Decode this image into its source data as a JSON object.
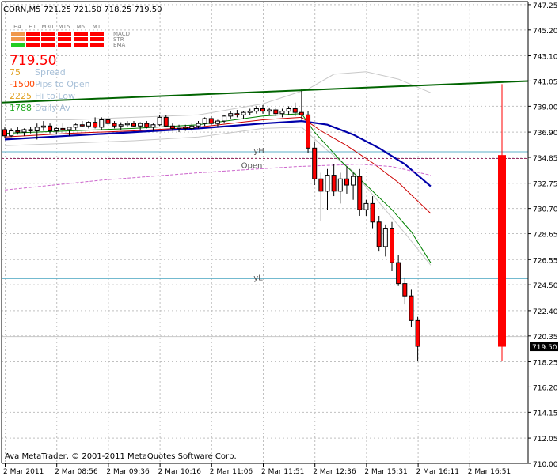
{
  "header": {
    "symbol": "CORN,M5",
    "ohlc": "721.25 721.50 718.25 719.50"
  },
  "indicator_panel": {
    "timeframes": [
      "H4",
      "H1",
      "M30",
      "M15",
      "M5",
      "M1"
    ],
    "row_labels": [
      "MACD",
      "STR",
      "EMA"
    ],
    "row_colors": [
      [
        "#f0984c",
        "#ff0000",
        "#ff0000",
        "#ff0000",
        "#ff0000",
        "#ff0000"
      ],
      [
        "#f0984c",
        "#ff0000",
        "#ff0000",
        "#ff0000",
        "#ff0000",
        "#ff0000"
      ],
      [
        "#22cc22",
        "#ff0000",
        "#ff0000",
        "#ff0000",
        "#ff0000",
        "#ff0000"
      ]
    ],
    "price": "719.50",
    "stats": [
      {
        "value": "75",
        "label": "Spread",
        "value_color": "#e0a020",
        "label_color": "#a8c0d8"
      },
      {
        "value": "-1500",
        "label": "Pips to Open",
        "value_color": "#ff4400",
        "label_color": "#a8c0d8"
      },
      {
        "value": "2225",
        "label": "Hi to Low",
        "value_color": "#e0a020",
        "label_color": "#a8c0d8"
      },
      {
        "value": "1788",
        "label": "Daily Av",
        "value_color": "#22aa22",
        "label_color": "#a8c0d8"
      }
    ]
  },
  "footer": {
    "copyright": "Ava MetaTrader, © 2001-2011 MetaQuotes Software Corp."
  },
  "chart_data": {
    "type": "candlestick",
    "y_range": [
      710.0,
      747.5
    ],
    "x_ticks": [
      {
        "index": 0,
        "label": "2 Mar 2011"
      },
      {
        "index": 8,
        "label": "2 Mar 08:56"
      },
      {
        "index": 16,
        "label": "2 Mar 09:36"
      },
      {
        "index": 24,
        "label": "2 Mar 10:16"
      },
      {
        "index": 32,
        "label": "2 Mar 11:06"
      },
      {
        "index": 40,
        "label": "2 Mar 11:51"
      },
      {
        "index": 48,
        "label": "2 Mar 12:36"
      },
      {
        "index": 56,
        "label": "2 Mar 15:31"
      },
      {
        "index": 64,
        "label": "2 Mar 16:11"
      },
      {
        "index": 72,
        "label": "2 Mar 16:51"
      }
    ],
    "y_ticks": [
      "747.25",
      "745.20",
      "743.10",
      "741.05",
      "739.00",
      "736.90",
      "734.85",
      "732.75",
      "730.70",
      "728.65",
      "726.55",
      "724.50",
      "722.40",
      "720.35",
      "718.25",
      "716.20",
      "714.15",
      "712.05",
      "710.00"
    ],
    "current_price": "719.50",
    "horizontal_lines": [
      {
        "label": "yH",
        "value": 735.3,
        "color": "#5fb0c8",
        "style": "solid"
      },
      {
        "label": "Open",
        "value": 734.75,
        "color": "#993366",
        "style": "dashed"
      },
      {
        "label": "yL",
        "value": 725.0,
        "color": "#5fb0c8",
        "style": "solid"
      },
      {
        "label": "",
        "value": 720.3,
        "color": "#c8c8c8",
        "style": "solid"
      }
    ],
    "trend_line": {
      "start": [
        0,
        739.3
      ],
      "end": [
        82,
        741.05
      ],
      "color": "#006400"
    },
    "candles": [
      [
        737.1,
        737.3,
        736.4,
        736.6
      ],
      [
        736.6,
        737.2,
        736.5,
        737.0
      ],
      [
        737.0,
        737.3,
        736.7,
        736.9
      ],
      [
        736.9,
        737.2,
        736.6,
        737.1
      ],
      [
        737.1,
        737.3,
        736.8,
        737.0
      ],
      [
        737.0,
        737.6,
        736.3,
        737.3
      ],
      [
        737.3,
        737.8,
        737.0,
        737.4
      ],
      [
        737.4,
        737.6,
        736.8,
        737.0
      ],
      [
        737.0,
        737.3,
        736.7,
        737.2
      ],
      [
        737.2,
        737.6,
        737.0,
        737.1
      ],
      [
        737.1,
        737.3,
        736.6,
        737.3
      ],
      [
        737.3,
        737.6,
        737.1,
        737.5
      ],
      [
        737.5,
        737.8,
        737.3,
        737.4
      ],
      [
        737.4,
        737.8,
        737.2,
        737.7
      ],
      [
        737.7,
        738.1,
        737.2,
        737.3
      ],
      [
        737.3,
        738.1,
        737.1,
        737.9
      ],
      [
        737.9,
        738.0,
        737.5,
        737.6
      ],
      [
        737.6,
        737.8,
        737.2,
        737.4
      ],
      [
        737.4,
        737.7,
        737.1,
        737.5
      ],
      [
        737.5,
        737.8,
        737.3,
        737.6
      ],
      [
        737.6,
        737.8,
        737.3,
        737.4
      ],
      [
        737.4,
        737.7,
        737.1,
        737.6
      ],
      [
        737.6,
        737.8,
        737.2,
        737.3
      ],
      [
        737.3,
        737.6,
        737.0,
        737.5
      ],
      [
        737.5,
        738.3,
        737.4,
        738.1
      ],
      [
        738.1,
        738.3,
        737.3,
        737.4
      ],
      [
        737.4,
        737.6,
        737.0,
        737.2
      ],
      [
        737.2,
        737.5,
        736.9,
        737.3
      ],
      [
        737.3,
        737.5,
        737.0,
        737.2
      ],
      [
        737.2,
        737.6,
        737.0,
        737.4
      ],
      [
        737.4,
        737.8,
        737.2,
        737.6
      ],
      [
        737.6,
        738.1,
        737.4,
        738.0
      ],
      [
        738.0,
        738.2,
        737.5,
        737.6
      ],
      [
        737.6,
        737.9,
        737.3,
        737.8
      ],
      [
        737.8,
        738.3,
        737.6,
        738.2
      ],
      [
        738.2,
        738.6,
        738.0,
        738.4
      ],
      [
        738.4,
        738.7,
        738.1,
        738.3
      ],
      [
        738.3,
        738.6,
        738.0,
        738.5
      ],
      [
        738.5,
        738.8,
        738.3,
        738.6
      ],
      [
        738.6,
        739.0,
        738.4,
        738.8
      ],
      [
        738.8,
        739.1,
        738.4,
        738.6
      ],
      [
        738.6,
        738.9,
        738.3,
        738.7
      ],
      [
        738.7,
        738.9,
        738.2,
        738.4
      ],
      [
        738.4,
        738.8,
        738.1,
        738.6
      ],
      [
        738.6,
        739.0,
        738.3,
        738.8
      ],
      [
        738.8,
        739.3,
        738.2,
        738.5
      ],
      [
        738.5,
        740.4,
        737.9,
        738.3
      ],
      [
        738.3,
        738.6,
        735.2,
        735.6
      ],
      [
        735.6,
        736.1,
        732.6,
        733.1
      ],
      [
        733.1,
        733.6,
        729.7,
        732.1
      ],
      [
        732.1,
        733.9,
        730.6,
        733.4
      ],
      [
        733.4,
        734.3,
        731.7,
        732.1
      ],
      [
        732.1,
        733.6,
        731.1,
        733.1
      ],
      [
        733.1,
        734.1,
        731.9,
        732.6
      ],
      [
        732.6,
        733.6,
        731.4,
        733.3
      ],
      [
        733.3,
        733.9,
        730.1,
        730.6
      ],
      [
        730.6,
        731.4,
        730.1,
        731.1
      ],
      [
        731.1,
        731.7,
        729.1,
        729.6
      ],
      [
        729.6,
        730.1,
        727.2,
        727.6
      ],
      [
        727.6,
        729.4,
        726.8,
        729.1
      ],
      [
        729.1,
        729.6,
        725.6,
        726.3
      ],
      [
        726.3,
        726.9,
        724.4,
        724.6
      ],
      [
        724.6,
        725.1,
        722.9,
        723.6
      ],
      [
        723.6,
        724.1,
        721.1,
        721.6
      ],
      [
        721.6,
        721.9,
        718.3,
        719.5
      ],
      [
        735.0,
        740.8,
        718.3,
        719.5
      ]
    ],
    "ma_series": [
      {
        "name": "",
        "color": "#0000aa",
        "width": 2.2,
        "points": [
          [
            0,
            736.3
          ],
          [
            10,
            736.6
          ],
          [
            20,
            736.9
          ],
          [
            30,
            737.2
          ],
          [
            40,
            737.6
          ],
          [
            46,
            737.8
          ],
          [
            50,
            737.5
          ],
          [
            54,
            736.7
          ],
          [
            58,
            735.6
          ],
          [
            62,
            734.3
          ],
          [
            66,
            732.5
          ]
        ]
      },
      {
        "name": "",
        "color": "#cc0000",
        "width": 1,
        "points": [
          [
            0,
            736.5
          ],
          [
            10,
            736.8
          ],
          [
            20,
            737.0
          ],
          [
            30,
            737.3
          ],
          [
            40,
            737.9
          ],
          [
            46,
            738.1
          ],
          [
            49,
            737.0
          ],
          [
            53,
            735.8
          ],
          [
            57,
            734.4
          ],
          [
            61,
            732.8
          ],
          [
            66,
            730.3
          ]
        ]
      },
      {
        "name": "",
        "color": "#008000",
        "width": 1,
        "points": [
          [
            0,
            736.8
          ],
          [
            10,
            737.0
          ],
          [
            20,
            737.2
          ],
          [
            30,
            737.5
          ],
          [
            40,
            738.2
          ],
          [
            46,
            738.4
          ],
          [
            48,
            736.9
          ],
          [
            52,
            734.6
          ],
          [
            56,
            732.6
          ],
          [
            60,
            730.6
          ],
          [
            63,
            728.8
          ],
          [
            66,
            726.3
          ]
        ]
      },
      {
        "name": "",
        "color": "#cc66cc",
        "width": 1,
        "dashed": true,
        "points": [
          [
            0,
            732.2
          ],
          [
            15,
            733.0
          ],
          [
            30,
            733.6
          ],
          [
            45,
            734.1
          ],
          [
            55,
            734.3
          ],
          [
            60,
            734.1
          ],
          [
            66,
            733.4
          ]
        ]
      }
    ],
    "bands": {
      "color": "#c8c8c8",
      "upper": [
        [
          0,
          737.9
        ],
        [
          10,
          737.9
        ],
        [
          20,
          738.1
        ],
        [
          30,
          738.3
        ],
        [
          40,
          739.2
        ],
        [
          47,
          740.4
        ],
        [
          51,
          741.6
        ],
        [
          56,
          741.8
        ],
        [
          61,
          741.2
        ],
        [
          66,
          740.1
        ]
      ],
      "lower": [
        [
          0,
          735.8
        ],
        [
          10,
          736.0
        ],
        [
          20,
          736.2
        ],
        [
          30,
          736.5
        ],
        [
          40,
          737.2
        ],
        [
          46,
          737.3
        ],
        [
          50,
          735.4
        ],
        [
          54,
          733.7
        ],
        [
          58,
          731.2
        ],
        [
          62,
          728.7
        ],
        [
          66,
          726.1
        ]
      ]
    }
  }
}
